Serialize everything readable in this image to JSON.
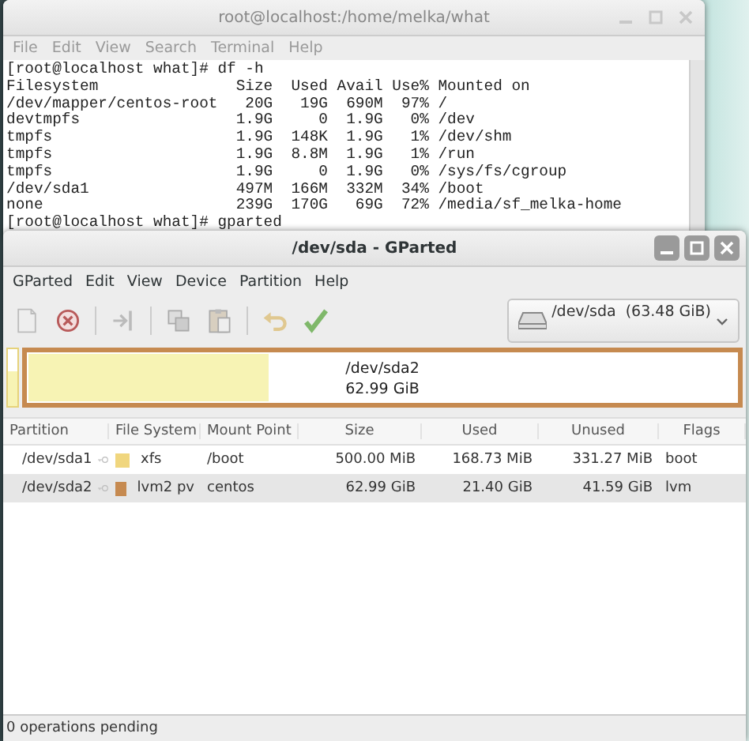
{
  "terminal": {
    "title": "root@localhost:/home/melka/what",
    "menu": [
      "File",
      "Edit",
      "View",
      "Search",
      "Terminal",
      "Help"
    ],
    "lines": [
      "[root@localhost what]# df -h",
      "Filesystem               Size  Used Avail Use% Mounted on",
      "/dev/mapper/centos-root   20G   19G  690M  97% /",
      "devtmpfs                 1.9G     0  1.9G   0% /dev",
      "tmpfs                    1.9G  148K  1.9G   1% /dev/shm",
      "tmpfs                    1.9G  8.8M  1.9G   1% /run",
      "tmpfs                    1.9G     0  1.9G   0% /sys/fs/cgroup",
      "/dev/sda1                497M  166M  332M  34% /boot",
      "none                     239G  170G   69G  72% /media/sf_melka-home",
      "[root@localhost what]# gparted"
    ]
  },
  "gparted": {
    "title": "/dev/sda - GParted",
    "menu": [
      "GParted",
      "Edit",
      "View",
      "Device",
      "Partition",
      "Help"
    ],
    "toolbar": [
      {
        "kind": "new"
      },
      {
        "kind": "delete"
      },
      {
        "kind": "sep"
      },
      {
        "kind": "resize"
      },
      {
        "kind": "sep"
      },
      {
        "kind": "copy"
      },
      {
        "kind": "paste"
      },
      {
        "kind": "sep"
      },
      {
        "kind": "undo"
      },
      {
        "kind": "apply"
      }
    ],
    "device": "/dev/sda  (63.48 GiB)",
    "disk_map": [
      {
        "color": "#e6d27a",
        "level": 0.6,
        "kind": "sliver"
      },
      {
        "color": "#c68a50",
        "level": 0.34,
        "kind": "box",
        "name": "/dev/sda2",
        "size": "62.99 GiB"
      }
    ],
    "columns": [
      "Partition",
      "File System",
      "Mount Point",
      "Size",
      "Used",
      "Unused",
      "Flags"
    ],
    "rows": [
      {
        "partition": "/dev/sda1",
        "color": "#f0d67e",
        "file_system": "xfs",
        "mount_point": "/boot",
        "size": "500.00 MiB",
        "used": "168.73 MiB",
        "unused": "331.27 MiB",
        "flags": "boot",
        "selected": false
      },
      {
        "partition": "/dev/sda2",
        "color": "#c68a50",
        "file_system": "lvm2 pv",
        "mount_point": "centos",
        "size": "62.99 GiB",
        "used": "21.40 GiB",
        "unused": "41.59 GiB",
        "flags": "lvm",
        "selected": true
      }
    ],
    "status": "0 operations pending"
  }
}
